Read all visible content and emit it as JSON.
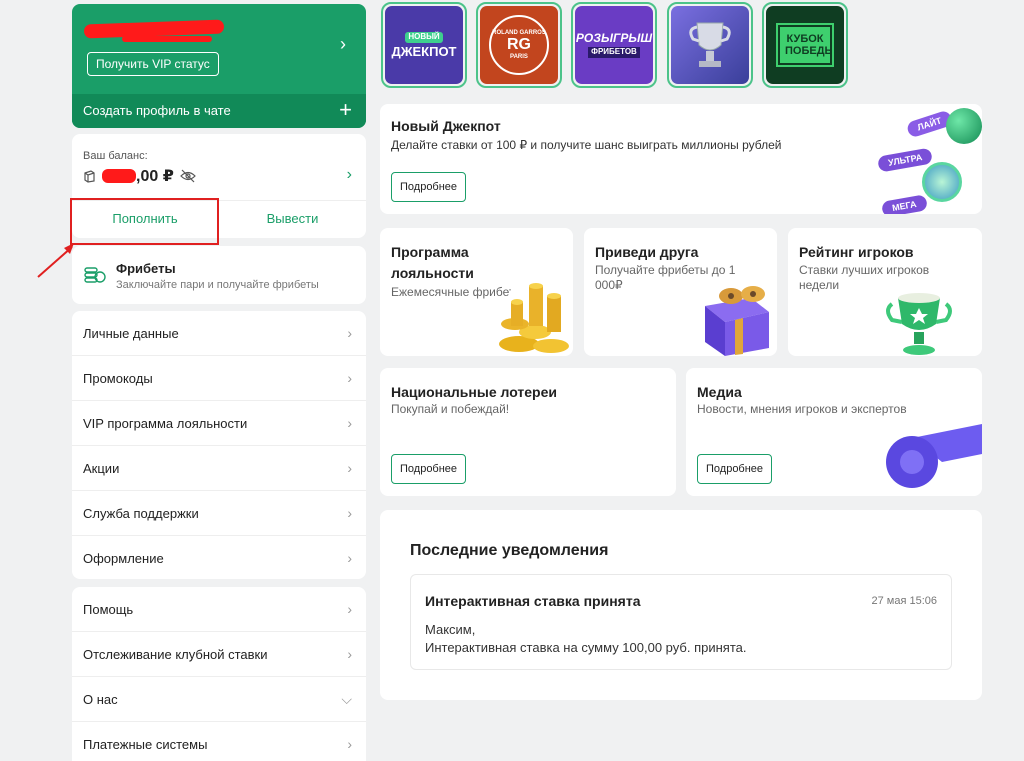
{
  "profile": {
    "vip_button": "Получить VIP статус",
    "create_profile": "Создать профиль в чате"
  },
  "balance": {
    "label": "Ваш баланс:",
    "amount_suffix": ",00 ₽",
    "topup": "Пополнить",
    "withdraw": "Вывести"
  },
  "freebets": {
    "title": "Фрибеты",
    "subtitle": "Заключайте пари и получайте фрибеты"
  },
  "menu1": [
    {
      "label": "Личные данные"
    },
    {
      "label": "Промокоды"
    },
    {
      "label": "VIP программа лояльности"
    },
    {
      "label": "Акции"
    },
    {
      "label": "Служба поддержки"
    },
    {
      "label": "Оформление"
    }
  ],
  "menu2": [
    {
      "label": "Помощь"
    },
    {
      "label": "Отслеживание клубной ставки"
    },
    {
      "label": "О нас"
    },
    {
      "label": "Платежные системы"
    }
  ],
  "banners": [
    {
      "text_top": "НОВЫЙ",
      "text": "ДЖЕКПОТ",
      "color": "#4a3aa8"
    },
    {
      "text_top": "ROLAND GARROS",
      "text": "RG",
      "text_bottom": "PARIS",
      "color": "#c2451e"
    },
    {
      "text": "РОЗЫГРЫШ",
      "text_bottom": "ФРИБЕТОВ",
      "color": "#6a3cc4"
    },
    {
      "text": "",
      "color": "#5b5fc7"
    },
    {
      "text": "КУБОК ПОБЕДЫ",
      "color": "#0f3d22"
    }
  ],
  "jackpot": {
    "title": "Новый Джекпот",
    "subtitle": "Делайте ставки от 100 ₽ и получите шанс выиграть миллионы рублей",
    "button": "Подробнее",
    "tags": [
      "ЛАЙТ",
      "УЛЬТРА",
      "МЕГА"
    ]
  },
  "promos": [
    {
      "title": "Программа лояльности",
      "subtitle": "Ежемесячные фрибеты"
    },
    {
      "title": "Приведи друга",
      "subtitle": "Получайте фрибеты до 1 000₽"
    },
    {
      "title": "Рейтинг игроков",
      "subtitle": "Ставки лучших игроков недели"
    }
  ],
  "lottery": {
    "title": "Национальные лотереи",
    "subtitle": "Покупай и побеждай!",
    "button": "Подробнее"
  },
  "media": {
    "title": "Медиа",
    "subtitle": "Новости, мнения игроков и экспертов",
    "button": "Подробнее"
  },
  "notifications": {
    "title": "Последние уведомления",
    "item": {
      "title": "Интерактивная ставка принята",
      "time": "27 мая 15:06",
      "line1": "Максим,",
      "line2": "Интерактивная ставка на сумму 100,00 руб. принята."
    }
  },
  "colors": {
    "brand": "#1a9e68",
    "brand_dark": "#118a58",
    "highlight": "#e02020"
  }
}
